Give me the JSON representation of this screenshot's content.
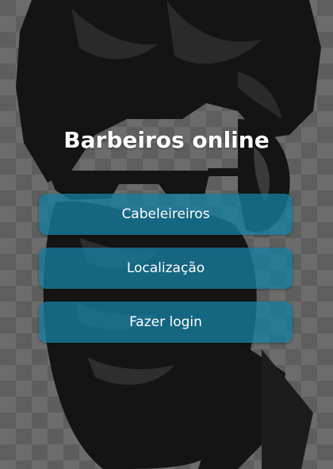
{
  "page": {
    "title": "Barbeiros online"
  },
  "menu": {
    "items": [
      {
        "label": "Cabeleireiros"
      },
      {
        "label": "Localização"
      },
      {
        "label": "Fazer login"
      }
    ]
  },
  "colors": {
    "button": "#167da0",
    "text": "#ffffff",
    "background": "#5e5e5e",
    "art": "#141414"
  },
  "background": {
    "illustration": "barber-silhouette-illustration"
  }
}
